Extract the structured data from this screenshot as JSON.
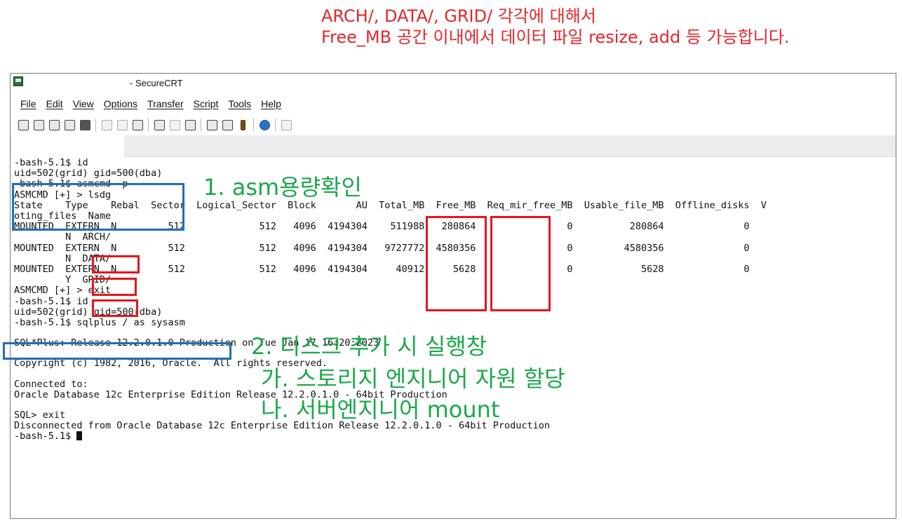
{
  "caption": {
    "line1": "ARCH/, DATA/, GRID/ 각각에 대해서",
    "line2": "Free_MB 공간 이내에서 데이터 파일 resize, add 등 가능합니다."
  },
  "window": {
    "title": "- SecureCRT",
    "menu": [
      "File",
      "Edit",
      "View",
      "Options",
      "Transfer",
      "Script",
      "Tools",
      "Help"
    ],
    "toolbar_icons": [
      "connect-icon",
      "quick-connect-icon",
      "connect-tab-icon",
      "reconnect-icon",
      "disconnect-icon",
      "copy-icon",
      "paste-icon",
      "find-icon",
      "print-icon",
      "print-selection-icon",
      "print-setup-icon",
      "session-options-icon",
      "global-options-icon",
      "keymap-icon",
      "help-icon",
      "sftp-icon"
    ]
  },
  "terminal": {
    "lines_block1": [
      "-bash-5.1$ id",
      "uid=502(grid) gid=500(dba)",
      "-bash-5.1$ asmcmd -p",
      "ASMCMD [+] > lsdg",
      "State    Type    Rebal  Sector  Logical_Sector  Block       AU  Total_MB  Free_MB  Req_mir_free_MB  Usable_file_MB  Offline_disks  V",
      "oting_files  Name",
      "MOUNTED  EXTERN  N         512             512   4096  4194304    511988   280864                0          280864              0",
      "         N  ARCH/",
      "MOUNTED  EXTERN  N         512             512   4096  4194304   9727772  4580356                0         4580356              0",
      "         N  DATA/",
      "MOUNTED  EXTERN  N         512             512   4096  4194304     40912     5628                0            5628              0",
      "         Y  GRID/",
      "ASMCMD [+] > exit",
      "-bash-5.1$ id",
      "uid=502(grid) gid=500(dba)",
      "-bash-5.1$ sqlplus / as sysasm"
    ],
    "line_sqlplus": "SQL*Plus: Release 12.2.0.1.0 Production on Tue Jan 17 16:20:2023",
    "line_copyright": "Copyright (c) 1982, 2016, Oracle.  All rights reserved.",
    "lines_connected": [
      "Connected to:",
      "Oracle Database 12c Enterprise Edition Release 12.2.0.1.0 - 64bit Production"
    ],
    "lines_exit": [
      "SQL> exit",
      "Disconnected from Oracle Database 12c Enterprise Edition Release 12.2.0.1.0 - 64bit Production"
    ],
    "prompt_last": "-bash-5.1$ "
  },
  "annotations": {
    "step1": "1. asm용량확인",
    "step2": "2. 디스크 추가 시 실행창",
    "step2a": "가. 스토리지 엔지니어 자원 할당",
    "step2b": "나. 서버엔지니어 mount"
  },
  "colors": {
    "caption": "#e8242b",
    "note": "#1aa84a",
    "box_blue": "#1f6fb5",
    "box_red": "#e4161c"
  }
}
